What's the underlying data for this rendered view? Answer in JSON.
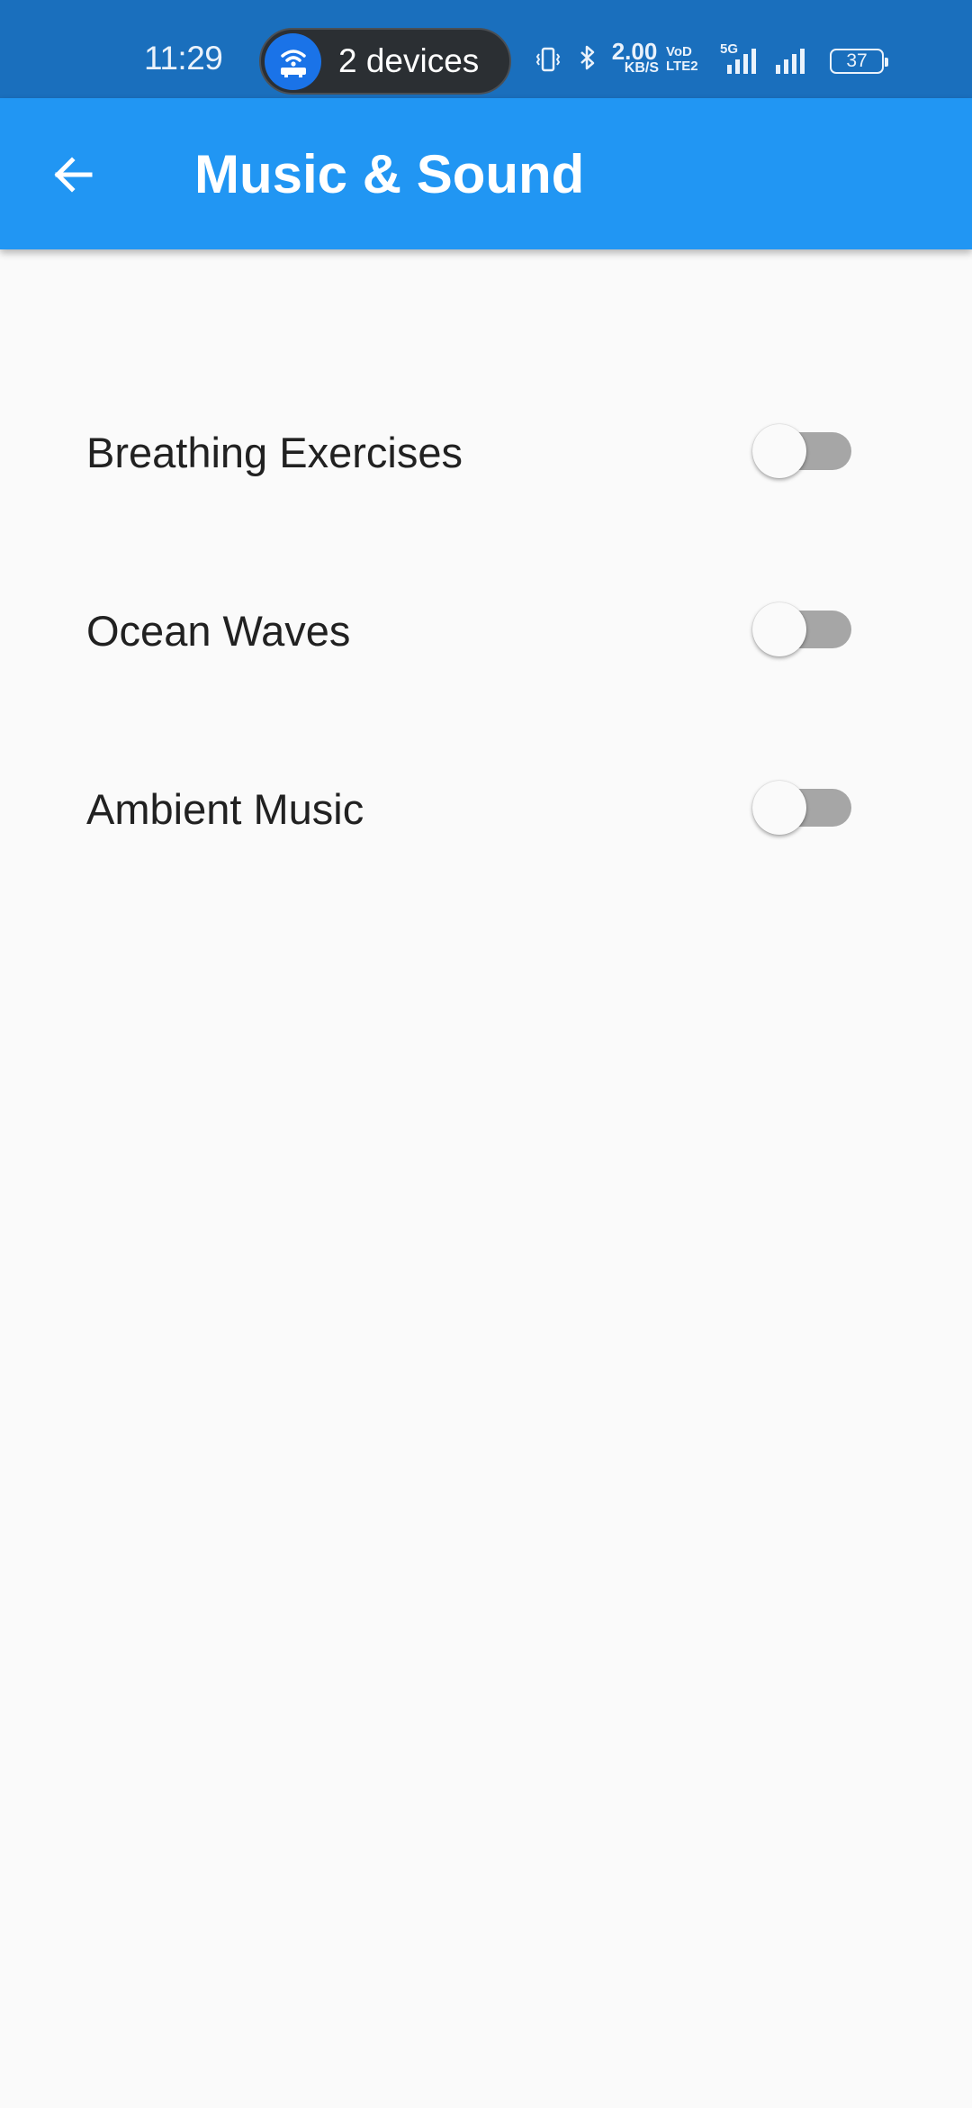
{
  "status_bar": {
    "time": "11:29",
    "hotspot_label": "2 devices",
    "net_speed_value": "2.00",
    "net_speed_unit": "KB/S",
    "volte_top": "VoD",
    "volte_bottom": "LTE2",
    "network_type": "5G",
    "battery_level": "37"
  },
  "app_bar": {
    "title": "Music & Sound",
    "back_icon": "arrow-back-icon",
    "background_color": "#2196f3"
  },
  "settings": {
    "items": [
      {
        "label": "Breathing Exercises",
        "enabled": false
      },
      {
        "label": "Ocean Waves",
        "enabled": false
      },
      {
        "label": "Ambient Music",
        "enabled": false
      }
    ]
  }
}
